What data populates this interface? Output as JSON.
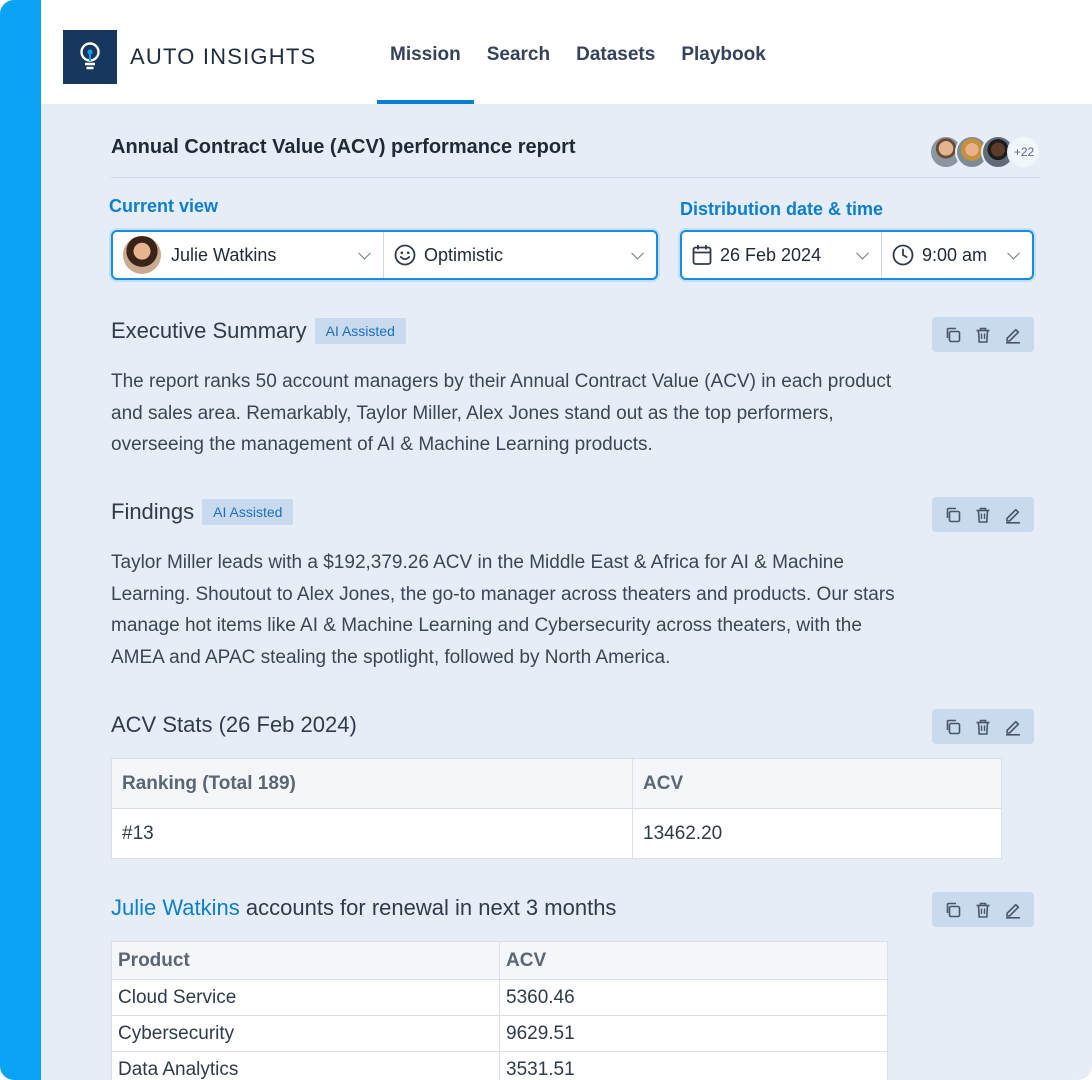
{
  "app": {
    "brand": "AUTO INSIGHTS",
    "logo_icon": "lightbulb-icon"
  },
  "nav": [
    {
      "label": "Mission",
      "active": true
    },
    {
      "label": "Search",
      "active": false
    },
    {
      "label": "Datasets",
      "active": false
    },
    {
      "label": "Playbook",
      "active": false
    }
  ],
  "report": {
    "title": "Annual Contract Value (ACV) performance report",
    "collaborators_more": "+22"
  },
  "current_view": {
    "label": "Current view",
    "user": "Julie Watkins",
    "tone": "Optimistic"
  },
  "distribution": {
    "label": "Distribution date & time",
    "date": "26 Feb 2024",
    "time": "9:00 am"
  },
  "executive_summary": {
    "title": "Executive Summary",
    "badge": "AI Assisted",
    "lines": [
      "The report ranks 50 account managers by their Annual Contract Value (ACV) in each product",
      "and sales area. Remarkably, Taylor Miller, Alex Jones  stand out as the top performers,",
      "overseeing the management of AI & Machine Learning products."
    ]
  },
  "findings": {
    "title": "Findings",
    "badge": "AI Assisted",
    "lines": [
      "Taylor Miller leads with a $192,379.26 ACV in the Middle East & Africa for AI & Machine",
      "Learning. Shoutout to Alex Jones, the go-to manager across theaters and products. Our stars",
      "manage hot items like AI & Machine Learning and Cybersecurity across theaters, with the",
      "AMEA and APAC stealing the spotlight, followed by North America."
    ]
  },
  "acv_stats": {
    "title": "ACV Stats (26 Feb 2024)",
    "headers": [
      "Ranking (Total 189)",
      "ACV"
    ],
    "row": [
      "#13",
      "13462.20"
    ]
  },
  "renewals": {
    "name": "Julie Watkins",
    "title_rest": " accounts for renewal in next 3 months",
    "headers": [
      "Product",
      "ACV"
    ],
    "rows": [
      [
        "Cloud Service",
        "5360.46"
      ],
      [
        "Cybersecurity",
        "9629.51"
      ],
      [
        "Data Analytics",
        "3531.51"
      ]
    ]
  },
  "colors": {
    "accent": "#0a7fd1",
    "left_bar": "#0aa2f5",
    "logo_bg": "#17375e",
    "badge_bg": "#c9d9ee"
  }
}
